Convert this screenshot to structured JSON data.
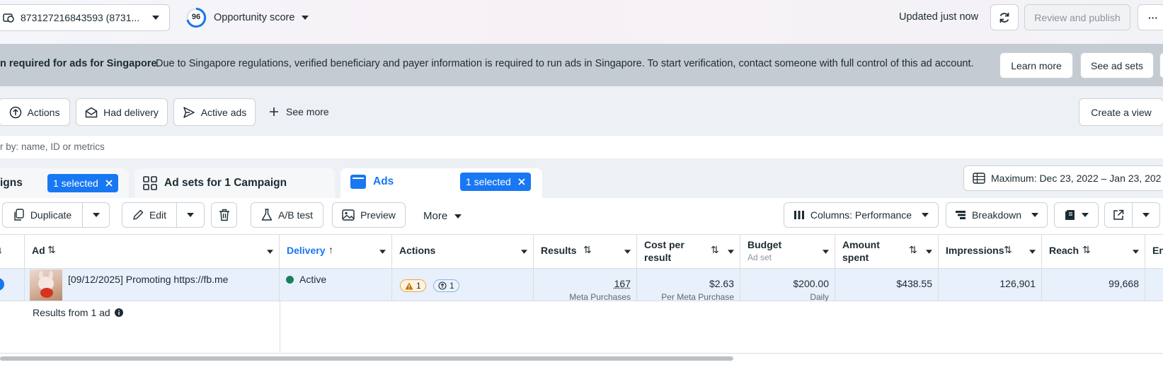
{
  "account": {
    "selector_label": "873127216843593 (8731..."
  },
  "opportunity": {
    "score": "96",
    "label": "Opportunity score"
  },
  "header": {
    "updated_text": "Updated just now",
    "review_label": "Review and publish",
    "more_label": "···"
  },
  "banner": {
    "title": "n required for ads for Singapore",
    "message": "Due to Singapore regulations, verified beneficiary and payer information is required to run ads in Singapore. To start verification, contact someone with full control of this ad account.",
    "learn_more": "Learn more",
    "see_ad_sets": "See ad sets"
  },
  "filters": {
    "actions": "Actions",
    "had_delivery": "Had delivery",
    "active_ads": "Active ads",
    "see_more": "See more",
    "create_view": "Create a view",
    "search_placeholder": "r by: name, ID or metrics"
  },
  "tabs": {
    "campaigns_label": "igns",
    "campaigns_selected": "1 selected",
    "adsets_label": "Ad sets for 1 Campaign",
    "ads_label": "Ads",
    "ads_selected": "1 selected",
    "date_range": "Maximum: Dec 23, 2022 – Jan 23, 202"
  },
  "toolbar": {
    "duplicate": "Duplicate",
    "edit": "Edit",
    "ab_test": "A/B test",
    "preview": "Preview",
    "more": "More",
    "columns": "Columns: Performance",
    "breakdown": "Breakdown"
  },
  "table": {
    "headers": {
      "ad": "Ad",
      "delivery": "Delivery",
      "actions": "Actions",
      "results": "Results",
      "cost_per_result_1": "Cost per",
      "cost_per_result_2": "result",
      "budget": "Budget",
      "budget_sub": "Ad set",
      "amount_spent_1": "Amount",
      "amount_spent_2": "spent",
      "impressions": "Impressions",
      "reach": "Reach",
      "next": "En"
    },
    "row": {
      "ad_name": "[09/12/2025] Promoting https://fb.me",
      "delivery": "Active",
      "warning_count": "1",
      "issue_count": "1",
      "results": "167",
      "results_sub": "Meta Purchases",
      "cost_per_result": "$2.63",
      "cost_sub": "Per Meta Purchase",
      "budget": "$200.00",
      "budget_sub": "Daily",
      "amount_spent": "$438.55",
      "impressions": "126,901",
      "reach": "99,668"
    },
    "summary": "Results from 1 ad"
  },
  "colors": {
    "accent": "#1877f2",
    "active_dot": "#1b7f5e",
    "warning": "#f0a500"
  }
}
